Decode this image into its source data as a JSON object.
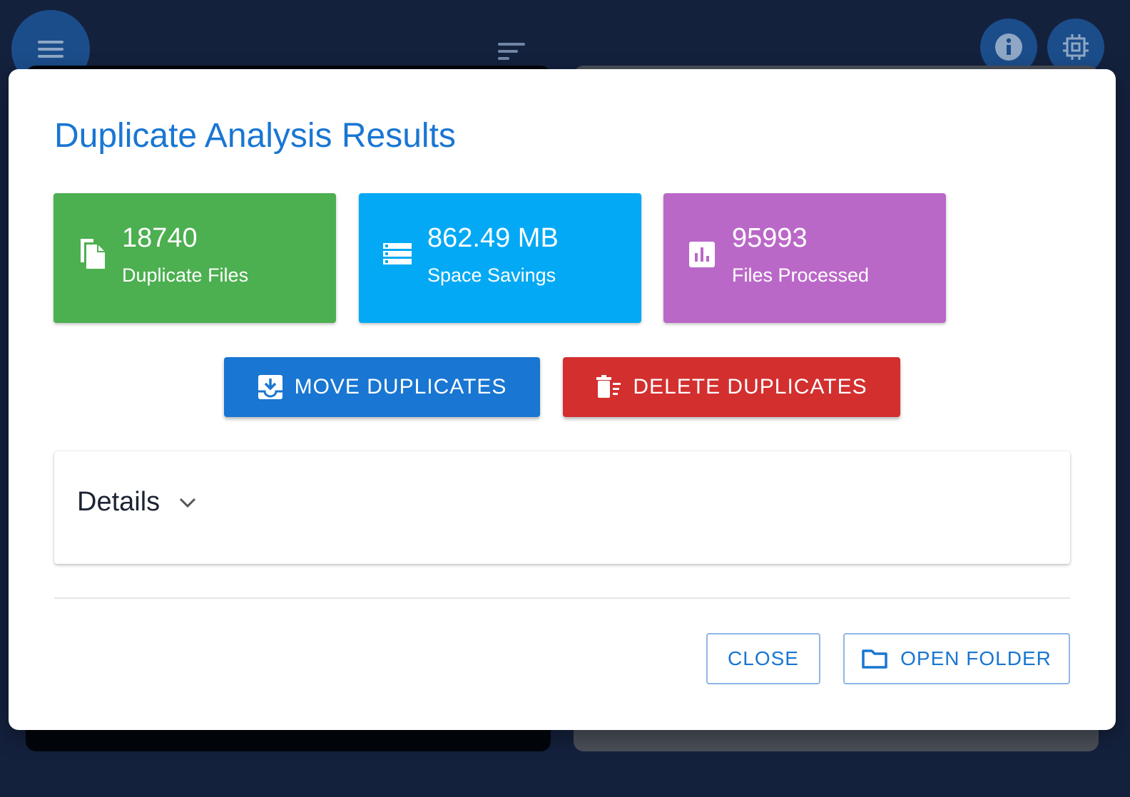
{
  "background": {
    "menu_icon": "hamburger-icon",
    "sort_icon": "sort-icon",
    "info_icon": "info-icon",
    "chip_icon": "chip-icon"
  },
  "dialog": {
    "title": "Duplicate Analysis Results",
    "stats": [
      {
        "value": "18740",
        "label": "Duplicate Files",
        "color": "#4caf50",
        "icon": "file-copy-icon"
      },
      {
        "value": "862.49 MB",
        "label": "Space Savings",
        "color": "#03a9f4",
        "icon": "storage-icon"
      },
      {
        "value": "95993",
        "label": "Files Processed",
        "color": "#ba68c8",
        "icon": "bar-chart-icon"
      }
    ],
    "actions": {
      "move_label": "MOVE DUPLICATES",
      "move_color": "#1976d2",
      "delete_label": "DELETE DUPLICATES",
      "delete_color": "#d32f2f"
    },
    "details": {
      "title": "Details"
    },
    "footer": {
      "close_label": "CLOSE",
      "open_folder_label": "OPEN FOLDER"
    }
  }
}
